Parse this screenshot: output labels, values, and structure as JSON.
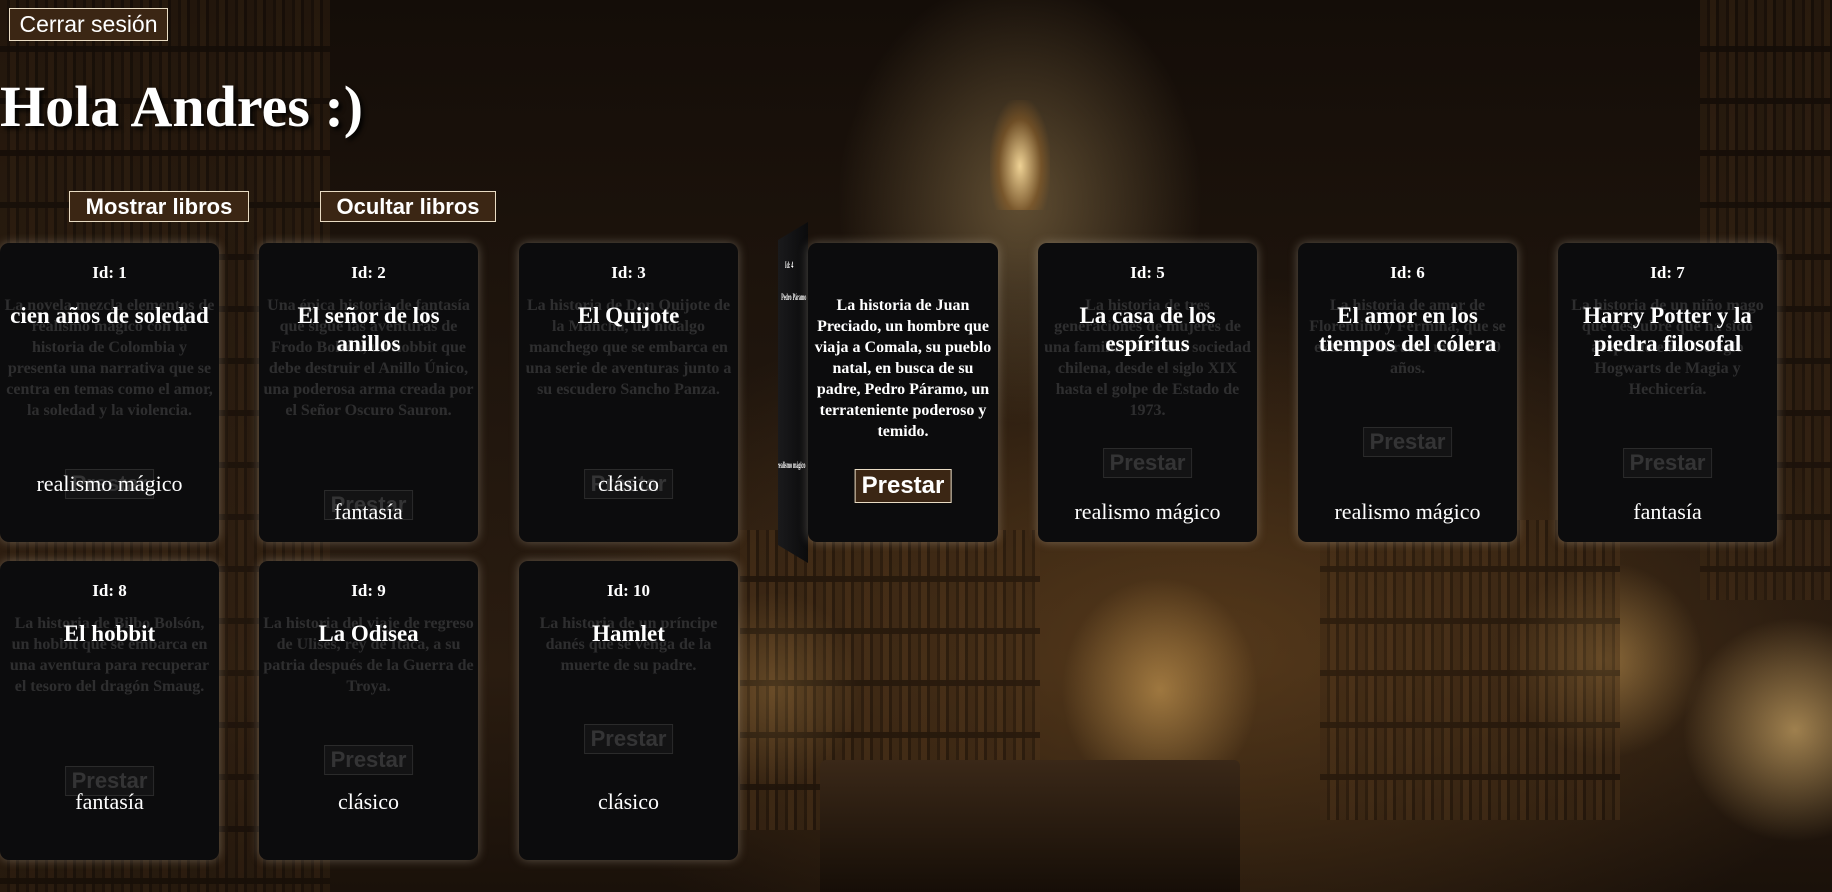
{
  "header": {
    "logout_label": "Cerrar sesión",
    "greeting": "Hola Andres :)",
    "show_books_label": "Mostrar libros",
    "hide_books_label": "Ocultar libros"
  },
  "lend_label": "Prestar",
  "books": [
    {
      "id_label": "Id: 1",
      "title": "cien años de soledad",
      "description": "La novela mezcla elementos de realismo mágico con la historia de Colombia y presenta una narrativa que se centra en temas como el amor, la soledad y la violencia.",
      "genre": "realismo mágico"
    },
    {
      "id_label": "Id: 2",
      "title": "El señor de los anillos",
      "description": "Una épica historia de fantasía que sigue las aventuras de Frodo Bolsón, un hobbit que debe destruir el Anillo Único, una poderosa arma creada por el Señor Oscuro Sauron.",
      "genre": "fantasía"
    },
    {
      "id_label": "Id: 3",
      "title": "El Quijote",
      "description": "La historia de Don Quijote de la Mancha, un hidalgo manchego que se embarca en una serie de aventuras junto a su escudero Sancho Panza.",
      "genre": "clásico"
    },
    {
      "id_label": "Id: 4",
      "title": "Pedro Páramo",
      "description": "La historia de Juan Preciado, un hombre que viaja a Comala, su pueblo natal, en busca de su padre, Pedro Páramo, un terrateniente poderoso y temido.",
      "genre": "realismo mágico"
    },
    {
      "id_label": "Id: 5",
      "title": "La casa de los espíritus",
      "description": "La historia de tres generaciones de mujeres de una familia de la alta sociedad chilena, desde el siglo XIX hasta el golpe de Estado de 1973.",
      "genre": "realismo mágico"
    },
    {
      "id_label": "Id: 6",
      "title": "El amor en los tiempos del cólera",
      "description": "La historia de amor de Florentino y Fermina, que se extiende durante más de 50 años.",
      "genre": "realismo mágico"
    },
    {
      "id_label": "Id: 7",
      "title": "Harry Potter y la piedra filosofal",
      "description": "La historia de un niño mago que descubre que ha sido aceptado en el Colegio Hogwarts de Magia y Hechicería.",
      "genre": "fantasía"
    },
    {
      "id_label": "Id: 8",
      "title": "El hobbit",
      "description": "La historia de Bilbo Bolsón, un hobbit que se embarca en una aventura para recuperar el tesoro del dragón Smaug.",
      "genre": "fantasía"
    },
    {
      "id_label": "Id: 9",
      "title": "La Odisea",
      "description": "La historia del viaje de regreso de Ulises, rey de Ítaca, a su patria después de la Guerra de Troya.",
      "genre": "clásico"
    },
    {
      "id_label": "Id: 10",
      "title": "Hamlet",
      "description": "La historia de un príncipe danés que se venga de la muerte de su padre.",
      "genre": "clásico"
    }
  ]
}
